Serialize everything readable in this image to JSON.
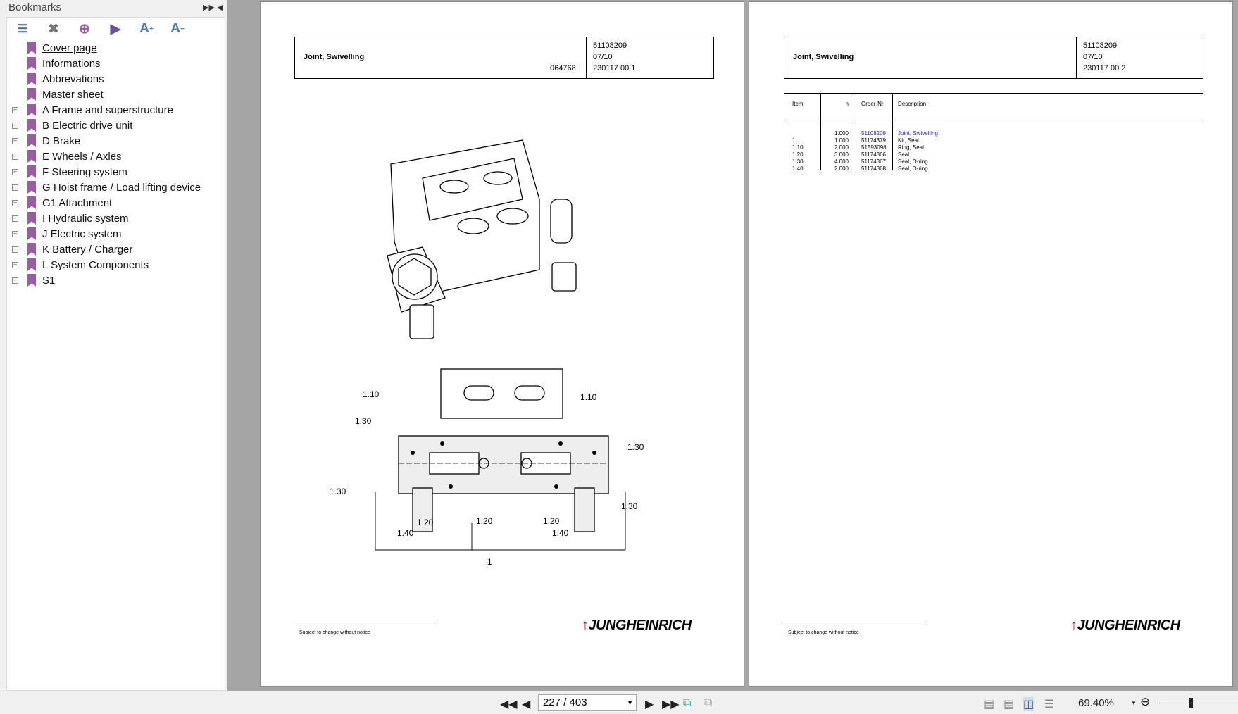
{
  "sidebar": {
    "title": "Bookmarks",
    "items": [
      {
        "label": "Cover page",
        "expandable": false
      },
      {
        "label": "Informations",
        "expandable": false
      },
      {
        "label": "Abbrevations",
        "expandable": false
      },
      {
        "label": "Master sheet",
        "expandable": false
      },
      {
        "label": "A Frame and superstructure",
        "expandable": true
      },
      {
        "label": "B Electric drive unit",
        "expandable": true
      },
      {
        "label": "D Brake",
        "expandable": true
      },
      {
        "label": "E Wheels / Axles",
        "expandable": true
      },
      {
        "label": "F Steering system",
        "expandable": true
      },
      {
        "label": "G Hoist frame / Load lifting device",
        "expandable": true
      },
      {
        "label": "G1 Attachment",
        "expandable": true
      },
      {
        "label": "I Hydraulic system",
        "expandable": true
      },
      {
        "label": "J Electric system",
        "expandable": true
      },
      {
        "label": "K Battery / Charger",
        "expandable": true
      },
      {
        "label": "L System Components",
        "expandable": true
      },
      {
        "label": "S1",
        "expandable": true
      }
    ]
  },
  "left_page": {
    "title": "Joint, Swivelling",
    "drawing_no": "064768",
    "part_no": "51108209",
    "date": "07/10",
    "ref": "230117 00 1",
    "callouts": [
      "1.10",
      "1.10",
      "1.30",
      "1.30",
      "1.30",
      "1.30",
      "1.20",
      "1.20",
      "1.20",
      "1.40",
      "1.40",
      "1"
    ],
    "footer": "Subject to change without notice",
    "logo": "JUNGHEINRICH"
  },
  "right_page": {
    "title": "Joint, Swivelling",
    "part_no": "51108209",
    "date": "07/10",
    "ref": "230117 00 2",
    "table": {
      "headers": [
        "Item",
        "n",
        "Order-Nr.",
        "Description"
      ],
      "rows": [
        [
          "",
          "1.000",
          "51108209",
          "Joint, Swivelling"
        ],
        [
          "1",
          "1.000",
          "51174379",
          "Kit, Seal"
        ],
        [
          "1.10",
          "2.000",
          "51593098",
          "Ring, Seal"
        ],
        [
          "1.20",
          "3.000",
          "51174366",
          "Seal"
        ],
        [
          "1.30",
          "4.000",
          "51174367",
          "Seal, O-ring"
        ],
        [
          "1.40",
          "2.000",
          "51174368",
          "Seal, O-ring"
        ]
      ]
    },
    "footer": "Subject to change without notice",
    "logo": "JUNGHEINRICH"
  },
  "toolbar": {
    "page": "227 / 403",
    "zoom": "69.40%",
    "zoom_level_fraction": 0.4
  },
  "colors": {
    "link": "#2a2adc",
    "bookmark": "#9b5ca6",
    "logo_red": "#d2001a"
  }
}
